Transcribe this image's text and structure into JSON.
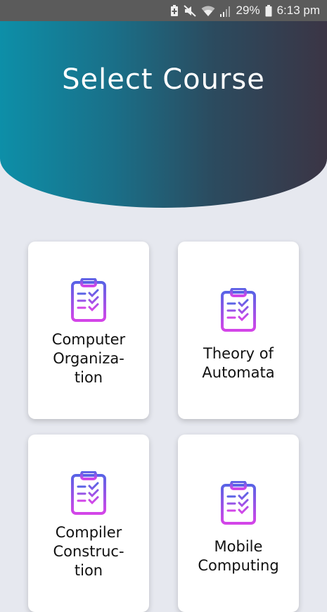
{
  "status_bar": {
    "battery_percent": "29%",
    "time": "6:13 pm",
    "icons": [
      "battery-saver-icon",
      "mute-icon",
      "wifi-icon",
      "signal-icon",
      "battery-icon"
    ]
  },
  "header": {
    "title": "Select Course",
    "gradient": [
      "#0d8fa8",
      "#3b3545"
    ]
  },
  "courses": [
    {
      "label": "Computer\nOrganiza-\ntion",
      "icon": "clipboard-checklist-icon"
    },
    {
      "label": "Theory of\nAutomata",
      "icon": "clipboard-checklist-icon"
    },
    {
      "label": "Compiler\nConstruc-\ntion",
      "icon": "clipboard-checklist-icon"
    },
    {
      "label": "Mobile\nComputing",
      "icon": "clipboard-checklist-icon"
    }
  ]
}
